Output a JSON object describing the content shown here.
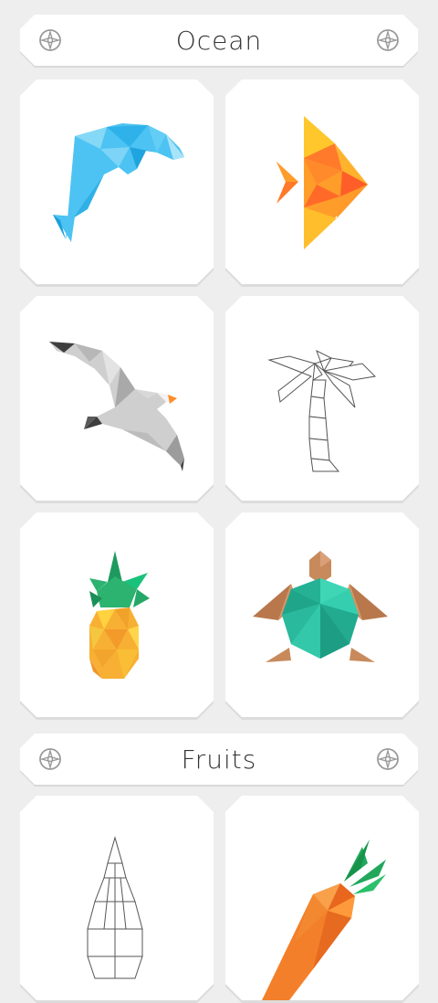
{
  "sections": [
    {
      "title": "Ocean",
      "items": [
        {
          "name": "dolphin",
          "icon": "dolphin-icon"
        },
        {
          "name": "fish",
          "icon": "fish-icon"
        },
        {
          "name": "seagull",
          "icon": "seagull-icon"
        },
        {
          "name": "palm-tree",
          "icon": "palm-tree-icon"
        },
        {
          "name": "pineapple",
          "icon": "pineapple-icon"
        },
        {
          "name": "turtle",
          "icon": "turtle-icon"
        }
      ]
    },
    {
      "title": "Fruits",
      "items": [
        {
          "name": "pear-outline",
          "icon": "pear-icon"
        },
        {
          "name": "carrot",
          "icon": "carrot-icon"
        }
      ]
    }
  ],
  "colors": {
    "background": "#eeeeee",
    "card": "#ffffff",
    "title_text": "#333333",
    "dolphin": "#4cc3f2",
    "fish": "#ff8f2b",
    "seagull": "#cfcfcf",
    "pineapple": "#f7b033",
    "pineapple_leaves": "#2bb36f",
    "turtle_shell": "#2cc4a6",
    "turtle_limbs": "#c88a5b",
    "carrot": "#f47f2a",
    "carrot_leaves": "#21a85b"
  }
}
